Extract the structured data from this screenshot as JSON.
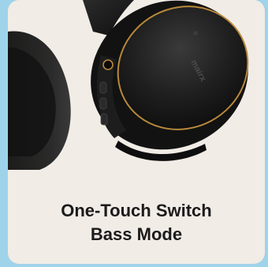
{
  "card": {
    "title_line1": "One-Touch Switch",
    "title_line2": "Bass Mode",
    "brand_text_on_headphone": "mairx"
  },
  "colors": {
    "page_background": "#9fd3ea",
    "card_background": "#f1ece6",
    "headphone_body": "#1c1c1c",
    "accent_ring": "#b8893b",
    "text": "#1b1b1b"
  }
}
